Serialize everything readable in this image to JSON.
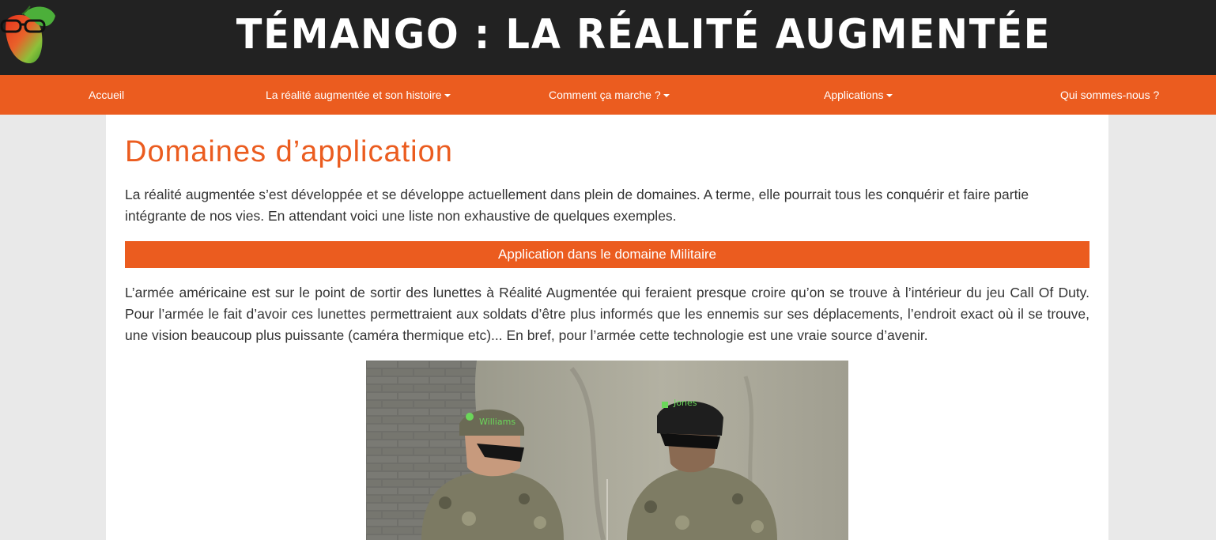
{
  "header": {
    "title": "TÉMANGO : LA RÉALITÉ AUGMENTÉE",
    "logo_icon": "mango-with-glasses-logo-icon"
  },
  "nav": {
    "items": [
      {
        "label": "Accueil",
        "has_dropdown": false
      },
      {
        "label": "La réalité augmentée et son histoire",
        "has_dropdown": true
      },
      {
        "label": "Comment ça marche ?",
        "has_dropdown": true
      },
      {
        "label": "Applications",
        "has_dropdown": true
      },
      {
        "label": "Qui sommes-nous ?",
        "has_dropdown": false
      }
    ]
  },
  "main": {
    "title": "Domaines d’application",
    "intro": "La réalité augmentée s’est développée et se développe actuellement dans plein de domaines. A terme, elle pourrait tous les conquérir et faire partie intégrante de nos vies. En attendant voici une liste non exhaustive de quelques exemples.",
    "section": {
      "heading": "Application dans le domaine Militaire",
      "text": "L’armée américaine est sur le point de sortir des lunettes à Réalité Augmentée qui feraient presque croire qu’on se trouve à l’intérieur du jeu Call Of Duty. Pour l’armée le fait d’avoir ces lunettes permettraient aux soldats d’être plus informés que les ennemis sur ses déplacements, l’endroit exact où il se trouve, une vision beaucoup plus puissante (caméra thermique etc)... En bref, pour l’armée cette technologie est une vraie source d’avenir.",
      "image_labels": [
        "Williams",
        "Jones"
      ]
    }
  },
  "colors": {
    "accent": "#eb5c1f",
    "header_bg": "#222222",
    "page_bg": "#e9e9e9"
  }
}
